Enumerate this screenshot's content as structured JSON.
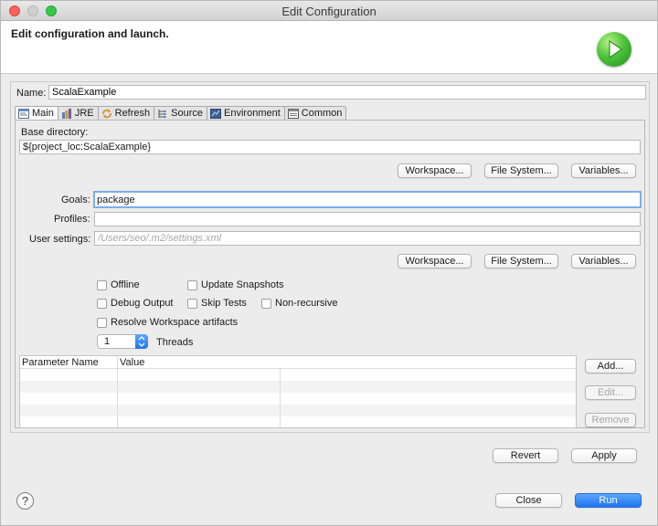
{
  "window": {
    "title": "Edit Configuration"
  },
  "header": {
    "title": "Edit configuration and launch."
  },
  "name": {
    "label": "Name:",
    "value": "ScalaExample"
  },
  "tabs": [
    {
      "label": "Main",
      "icon": "main-tab-icon",
      "active": true
    },
    {
      "label": "JRE",
      "icon": "jre-icon"
    },
    {
      "label": "Refresh",
      "icon": "refresh-icon"
    },
    {
      "label": "Source",
      "icon": "source-icon"
    },
    {
      "label": "Environment",
      "icon": "environment-icon"
    },
    {
      "label": "Common",
      "icon": "common-icon"
    }
  ],
  "main": {
    "base_dir_label": "Base directory:",
    "base_dir_value": "${project_loc:ScalaExample}",
    "workspace_btn": "Workspace...",
    "filesystem_btn": "File System...",
    "variables_btn": "Variables...",
    "goals_label": "Goals:",
    "goals_value": "package",
    "profiles_label": "Profiles:",
    "profiles_value": "",
    "user_settings_label": "User settings:",
    "user_settings_placeholder": "/Users/seo/.m2/settings.xml",
    "offline_label": "Offline",
    "update_snapshots_label": "Update Snapshots",
    "debug_output_label": "Debug Output",
    "skip_tests_label": "Skip Tests",
    "non_recursive_label": "Non-recursive",
    "resolve_workspace_label": "Resolve Workspace artifacts",
    "threads_value": "1",
    "threads_label": "Threads",
    "table": {
      "columns": [
        "Parameter Name",
        "Value"
      ],
      "rows": []
    },
    "add_btn": "Add...",
    "edit_btn": "Edit...",
    "remove_btn": "Remove"
  },
  "footer": {
    "revert_btn": "Revert",
    "apply_btn": "Apply",
    "close_btn": "Close",
    "run_btn": "Run",
    "help_glyph": "?"
  },
  "colors": {
    "accent": "#1f73f0",
    "run_badge": "#3bb52f",
    "focus_ring": "#7eadec"
  }
}
